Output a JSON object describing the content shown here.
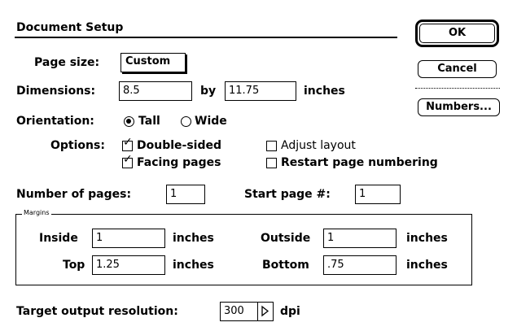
{
  "dialog": {
    "title": "Document Setup",
    "buttons": {
      "ok": "OK",
      "cancel": "Cancel",
      "numbers": "Numbers..."
    }
  },
  "page_size": {
    "label": "Page size:",
    "value": "Custom"
  },
  "dimensions": {
    "label": "Dimensions:",
    "width": "8.5",
    "by": "by",
    "height": "11.75",
    "unit": "inches"
  },
  "orientation": {
    "label": "Orientation:",
    "options": [
      "Tall",
      "Wide"
    ],
    "selected": "Tall"
  },
  "options": {
    "label": "Options:",
    "double_sided": {
      "label": "Double-sided",
      "checked": true
    },
    "facing_pages": {
      "label": "Facing pages",
      "checked": true
    },
    "adjust_layout": {
      "label": "Adjust layout",
      "checked": false
    },
    "restart_page_numbering": {
      "label": "Restart page numbering",
      "checked": false
    }
  },
  "pages": {
    "number_label": "Number of pages:",
    "number_value": "1",
    "start_label": "Start page #:",
    "start_value": "1"
  },
  "margins": {
    "group_label": "Margins",
    "inside_label": "Inside",
    "inside_value": "1",
    "outside_label": "Outside",
    "outside_value": "1",
    "top_label": "Top",
    "top_value": "1.25",
    "bottom_label": "Bottom",
    "bottom_value": ".75",
    "unit": "inches"
  },
  "resolution": {
    "label": "Target output resolution:",
    "value": "300",
    "unit": "dpi"
  }
}
